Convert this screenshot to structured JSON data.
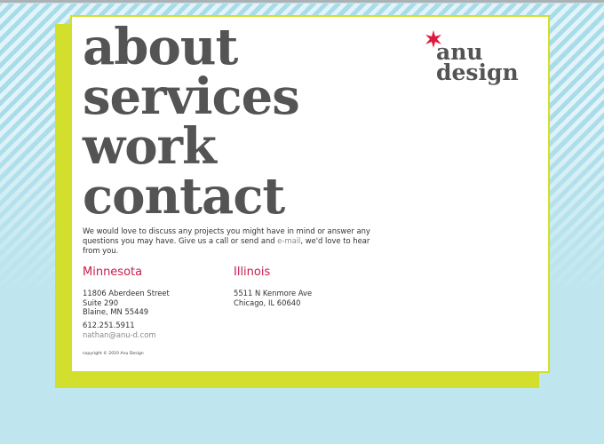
{
  "nav": {
    "items": [
      "about",
      "services",
      "work",
      "contact"
    ]
  },
  "logo": {
    "line1": "anu",
    "line2": "design",
    "star_color": "#e0183f"
  },
  "intro": {
    "text_before": "We would love to discuss any projects you might have in mind or answer any questions you may have. Give us a call or send and ",
    "link": "e-mail",
    "text_after": ", we'd love to hear from you."
  },
  "offices": [
    {
      "title": "Minnesota",
      "street": "11806 Aberdeen Street",
      "suite": "Suite 290",
      "city": "Blaine, MN 55449",
      "phone": "612.251.5911",
      "email": "nathan@anu-d.com"
    },
    {
      "title": "Illinois",
      "street": "5511 N Kenmore Ave",
      "city": "Chicago, IL 60640"
    }
  ],
  "copyright": "copyright © 2010 Anu Design",
  "colors": {
    "accent": "#c8204d",
    "frame": "#d2df2c",
    "heading": "#545454"
  }
}
